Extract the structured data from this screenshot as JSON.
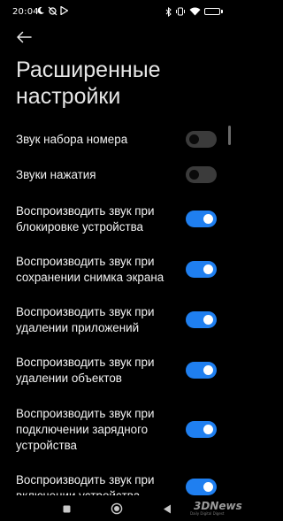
{
  "status_bar": {
    "time": "20:04",
    "left_icons": [
      "moon-icon",
      "no-sync-icon",
      "play-store-icon"
    ],
    "right_icons": [
      "bluetooth-icon",
      "vibrate-icon",
      "wifi-icon",
      "battery-icon"
    ],
    "battery_level": 0.9
  },
  "header": {
    "back_icon": "arrow-left-icon",
    "title": "Расширенные настройки"
  },
  "settings": [
    {
      "label": "Звук набора номера",
      "enabled": false
    },
    {
      "label": "Звуки нажатия",
      "enabled": false
    },
    {
      "label": "Воспроизводить звук при блокировке устройства",
      "enabled": true
    },
    {
      "label": "Воспроизводить звук при сохранении снимка экрана",
      "enabled": true
    },
    {
      "label": "Воспроизводить звук при удалении приложений",
      "enabled": true
    },
    {
      "label": "Воспроизводить звук при удалении объектов",
      "enabled": true
    },
    {
      "label": "Воспроизводить звук при подключении зарядного устройства",
      "enabled": true
    },
    {
      "label": "Воспроизводить звук при включении устройства",
      "enabled": true
    }
  ],
  "nav_bar": {
    "recents_icon": "square-icon",
    "home_icon": "circle-home-icon",
    "back_icon": "triangle-back-icon"
  },
  "watermark": {
    "main": "3DNews",
    "sub": "Daily Digital Digest"
  },
  "colors": {
    "background": "#000000",
    "toggle_on": "#1f7ff0",
    "toggle_off": "#3b3b3b",
    "text": "#f2f2f2"
  }
}
